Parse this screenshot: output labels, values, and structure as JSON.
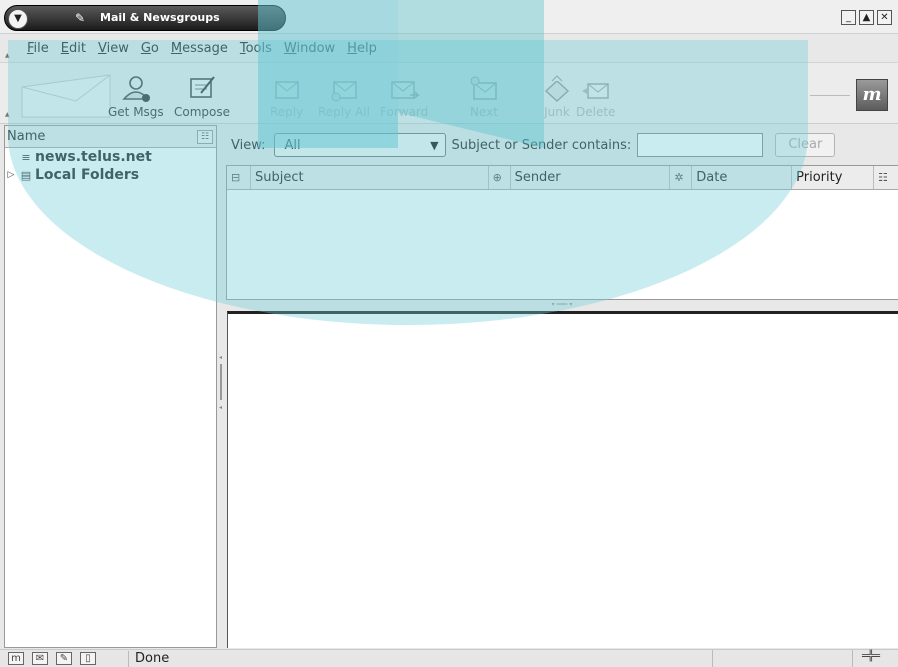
{
  "window": {
    "title": "Mail & Newsgroups",
    "controls": [
      "minimize",
      "maximize",
      "close"
    ]
  },
  "menubar": {
    "items": [
      "File",
      "Edit",
      "View",
      "Go",
      "Message",
      "Tools",
      "Window",
      "Help"
    ]
  },
  "toolbar": {
    "buttons": [
      {
        "label": "Get Msgs",
        "icon": "get-msgs-icon",
        "enabled": true
      },
      {
        "label": "Compose",
        "icon": "compose-icon",
        "enabled": true
      },
      {
        "label": "Reply",
        "icon": "reply-icon",
        "enabled": false
      },
      {
        "label": "Reply All",
        "icon": "reply-all-icon",
        "enabled": false
      },
      {
        "label": "Forward",
        "icon": "forward-icon",
        "enabled": false
      },
      {
        "label": "Next",
        "icon": "next-icon",
        "enabled": false
      },
      {
        "label": "Junk",
        "icon": "junk-icon",
        "enabled": false
      },
      {
        "label": "Delete",
        "icon": "delete-icon",
        "enabled": false
      }
    ]
  },
  "folder_pane": {
    "header": "Name",
    "folders": [
      {
        "name": "news.telus.net",
        "icon": "newsgroup-server-icon",
        "expandable": false
      },
      {
        "name": "Local Folders",
        "icon": "local-folders-icon",
        "expandable": true
      }
    ]
  },
  "filter_bar": {
    "view_label": "View:",
    "view_value": "All",
    "search_label": "Subject or Sender contains:",
    "search_value": "",
    "clear_label": "Clear"
  },
  "thread_pane": {
    "columns": [
      "Subject",
      "Sender",
      "Date",
      "Priority"
    ]
  },
  "status_bar": {
    "text": "Done"
  },
  "colors": {
    "watermark": "#70cdd7",
    "titlebar_pill": "#1b1b1b",
    "window_bg": "#e8e8e8"
  }
}
